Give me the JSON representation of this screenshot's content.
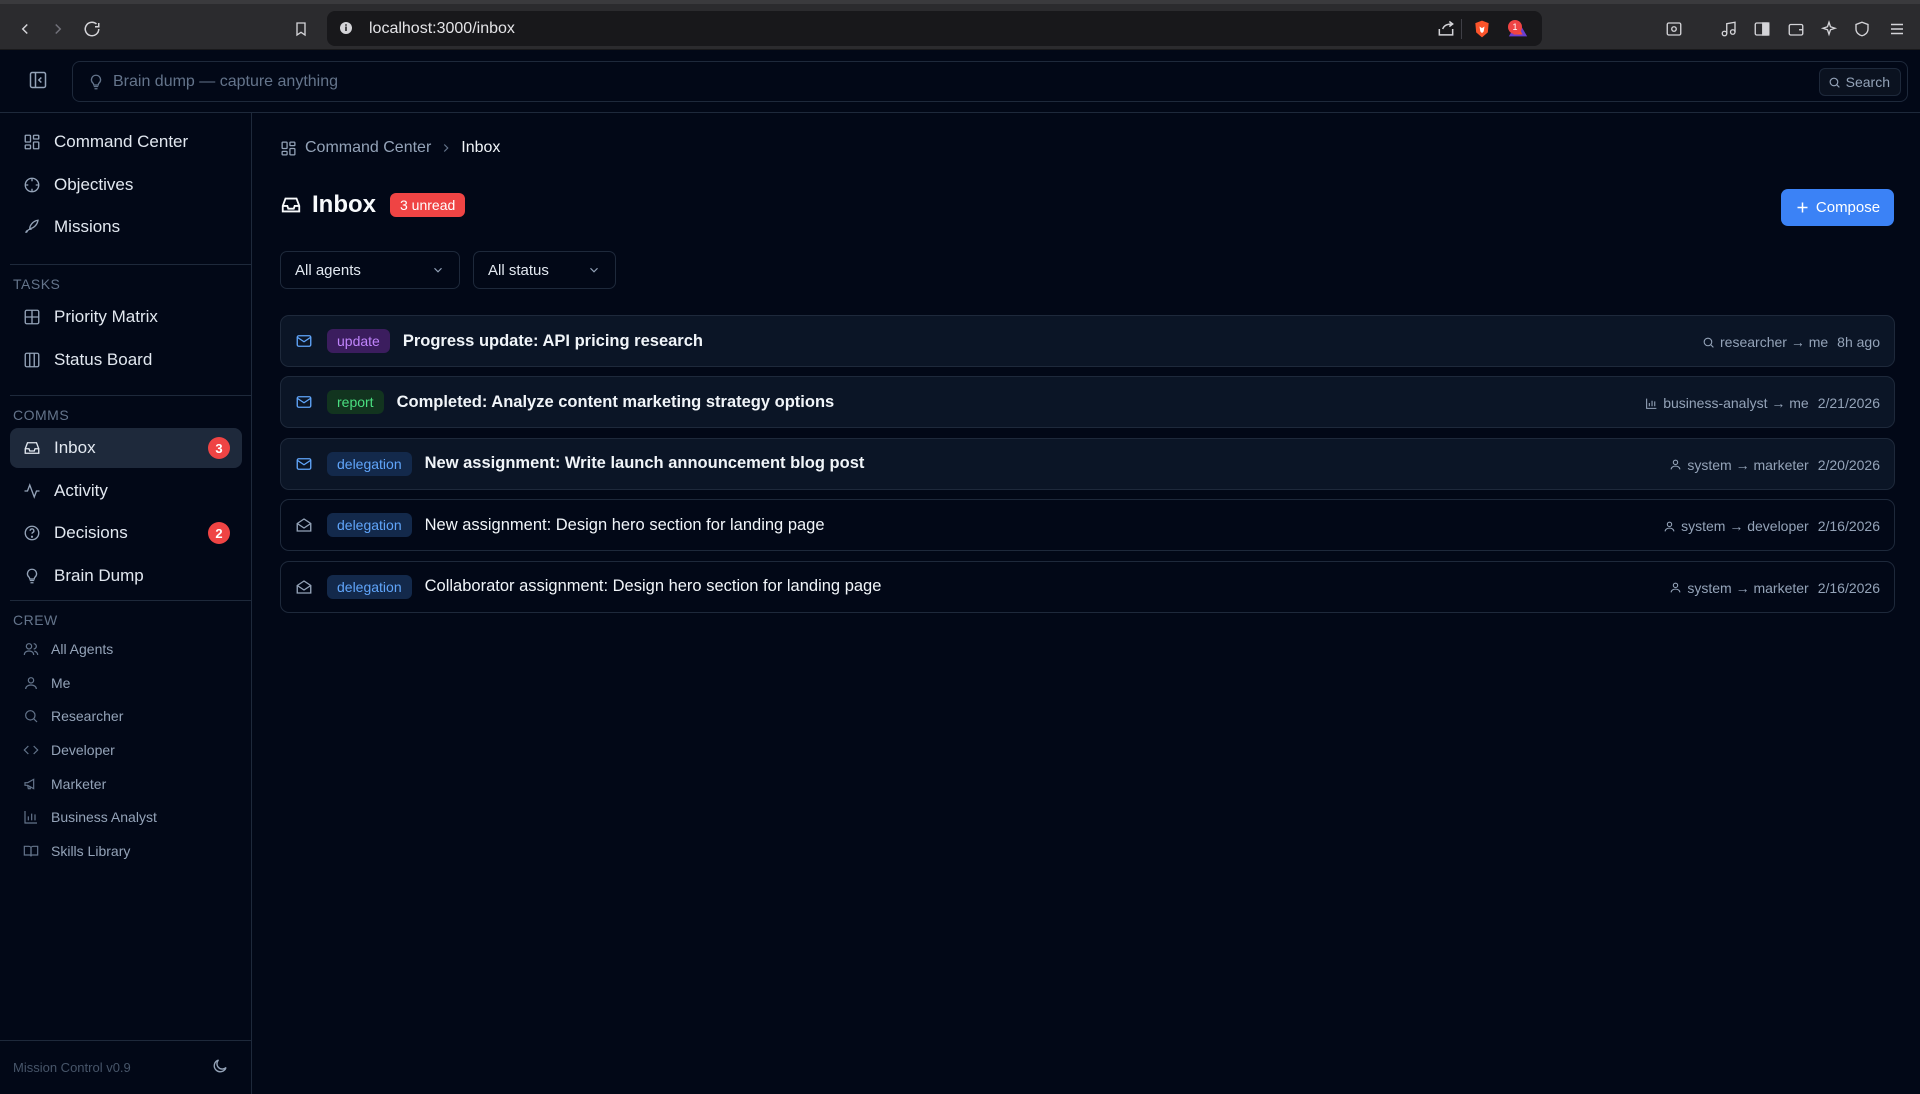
{
  "browser": {
    "url": "localhost:3000/inbox",
    "notification_count": "1"
  },
  "header": {
    "brain_dump_placeholder": "Brain dump — capture anything",
    "search_label": "Search"
  },
  "sidebar": {
    "top_items": [
      {
        "label": "Command Center",
        "icon": "layout-grid-icon"
      },
      {
        "label": "Objectives",
        "icon": "target-icon"
      },
      {
        "label": "Missions",
        "icon": "rocket-icon"
      }
    ],
    "tasks_label": "TASKS",
    "task_items": [
      {
        "label": "Priority Matrix",
        "icon": "grid-icon"
      },
      {
        "label": "Status Board",
        "icon": "columns-icon"
      }
    ],
    "comms_label": "COMMS",
    "comms_items": [
      {
        "label": "Inbox",
        "icon": "inbox-icon",
        "badge": "3",
        "active": true
      },
      {
        "label": "Activity",
        "icon": "activity-icon"
      },
      {
        "label": "Decisions",
        "icon": "help-circle-icon",
        "badge": "2"
      },
      {
        "label": "Brain Dump",
        "icon": "lightbulb-icon"
      }
    ],
    "crew_label": "CREW",
    "crew_items": [
      {
        "label": "All Agents",
        "icon": "users-icon"
      },
      {
        "label": "Me",
        "icon": "user-icon"
      },
      {
        "label": "Researcher",
        "icon": "search-icon"
      },
      {
        "label": "Developer",
        "icon": "code-icon"
      },
      {
        "label": "Marketer",
        "icon": "megaphone-icon"
      },
      {
        "label": "Business Analyst",
        "icon": "bar-chart-icon"
      },
      {
        "label": "Skills Library",
        "icon": "book-open-icon"
      }
    ],
    "version": "Mission Control v0.9"
  },
  "main": {
    "breadcrumb": {
      "parent": "Command Center",
      "current": "Inbox"
    },
    "title": "Inbox",
    "unread_badge": "3 unread",
    "compose_label": "Compose",
    "filters": {
      "agents": "All agents",
      "status": "All status"
    },
    "messages": [
      {
        "type": "update",
        "subject": "Progress update: API pricing research",
        "route": "researcher → me",
        "when": "8h ago",
        "unread": true,
        "icon": "search-icon"
      },
      {
        "type": "report",
        "subject": "Completed: Analyze content marketing strategy options",
        "route": "business-analyst → me",
        "when": "2/21/2026",
        "unread": true,
        "icon": "bar-chart-icon"
      },
      {
        "type": "delegation",
        "subject": "New assignment: Write launch announcement blog post",
        "route": "system → marketer",
        "when": "2/20/2026",
        "unread": true,
        "icon": "user-icon"
      },
      {
        "type": "delegation",
        "subject": "New assignment: Design hero section for landing page",
        "route": "system → developer",
        "when": "2/16/2026",
        "unread": false,
        "icon": "user-icon"
      },
      {
        "type": "delegation",
        "subject": "Collaborator assignment: Design hero section for landing page",
        "route": "system → marketer",
        "when": "2/16/2026",
        "unread": false,
        "icon": "user-icon"
      }
    ]
  },
  "colors": {
    "background": "#020817",
    "accent": "#3b82f6",
    "danger": "#ef4444",
    "tag_update": "#c084fc",
    "tag_report": "#4ade80",
    "tag_delegation": "#60a5fa"
  }
}
